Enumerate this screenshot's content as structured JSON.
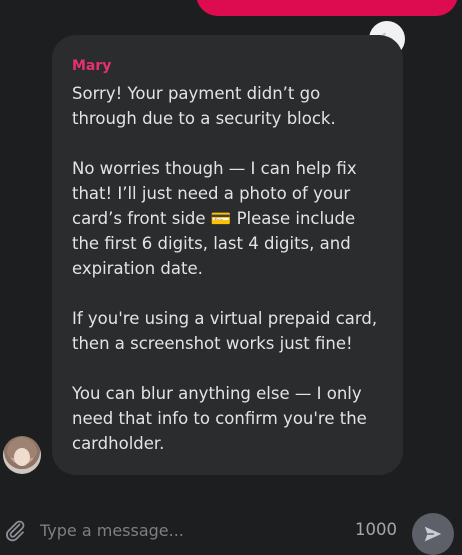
{
  "chat": {
    "message": {
      "sender": "Mary",
      "paragraphs": [
        "Sorry! Your payment didn’t go\nthrough due to a security block.",
        "No worries though — I can help fix\nthat! I’ll just need a photo of your\ncard’s front side 💳 Please include\nthe first 6 digits, last 4 digits, and\nexpiration date.",
        "If you're using a virtual prepaid card,\nthen a screenshot works just fine!",
        "You can blur anything else — I only\nneed that info to confirm you're the\ncardholder."
      ]
    }
  },
  "composer": {
    "placeholder": "Type a message...",
    "char_count": "1000"
  },
  "icons": {
    "reply": "reply-icon",
    "attach": "paperclip-icon",
    "send": "send-icon"
  },
  "colors": {
    "background": "#1d1e20",
    "bubble": "#2b2c2e",
    "accent": "#dd0b4f",
    "sender_name": "#e8306d"
  }
}
